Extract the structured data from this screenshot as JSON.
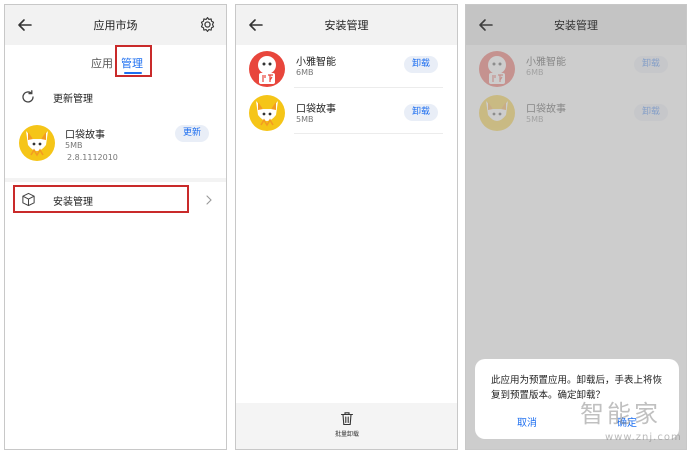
{
  "panel1": {
    "title": "应用市场",
    "tabs": [
      "应用",
      "管理"
    ],
    "update_label": "更新管理",
    "app": {
      "name": "口袋故事",
      "size": "5MB",
      "version": "2.8.1112010",
      "button": "更新"
    },
    "install_label": "安装管理"
  },
  "panel2": {
    "title": "安装管理",
    "apps": [
      {
        "name": "小雅智能",
        "size": "6MB",
        "button": "卸载"
      },
      {
        "name": "口袋故事",
        "size": "5MB",
        "button": "卸载"
      }
    ],
    "bulk_label": "批量卸载"
  },
  "panel3": {
    "title": "安装管理",
    "apps": [
      {
        "name": "小雅智能",
        "size": "6MB",
        "button": "卸载"
      },
      {
        "name": "口袋故事",
        "size": "5MB",
        "button": "卸载"
      }
    ],
    "dialog": {
      "message": "此应用为预置应用。卸载后，手表上将恢复到预置版本。确定卸载？",
      "cancel": "取消",
      "confirm": "确定"
    }
  },
  "watermark": {
    "brand": "智能家",
    "url": "www.znj.com"
  },
  "colors": {
    "accent": "#1e6ff0",
    "highlight": "#c92a2a",
    "xiaoya_red": "#e8463c",
    "story_yellow": "#f5c518"
  },
  "icons": [
    "back-arrow-icon",
    "gear-icon",
    "refresh-icon",
    "package-box-icon",
    "chevron-right-icon",
    "trash-icon"
  ]
}
